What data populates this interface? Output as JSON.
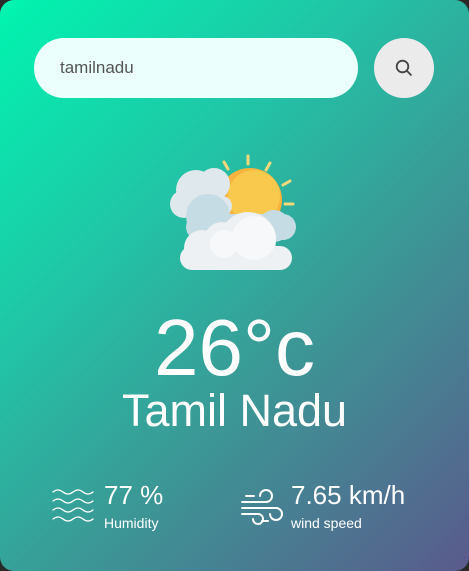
{
  "search": {
    "value": "tamilnadu",
    "icon": "search-icon"
  },
  "weather": {
    "icon": "partly-cloudy-sun-icon",
    "temperature": "26°c",
    "city": "Tamil Nadu"
  },
  "details": {
    "humidity": {
      "icon": "humidity-waves-icon",
      "value": "77 %",
      "label": "Humidity"
    },
    "wind": {
      "icon": "wind-icon",
      "value": "7.65 km/h",
      "label": "wind speed"
    }
  },
  "colors": {
    "gradient_start": "#00f5b0",
    "gradient_end": "#5a5a8c",
    "search_bg": "#ebfffc",
    "button_bg": "#ebebeb",
    "text": "#ffffff"
  }
}
